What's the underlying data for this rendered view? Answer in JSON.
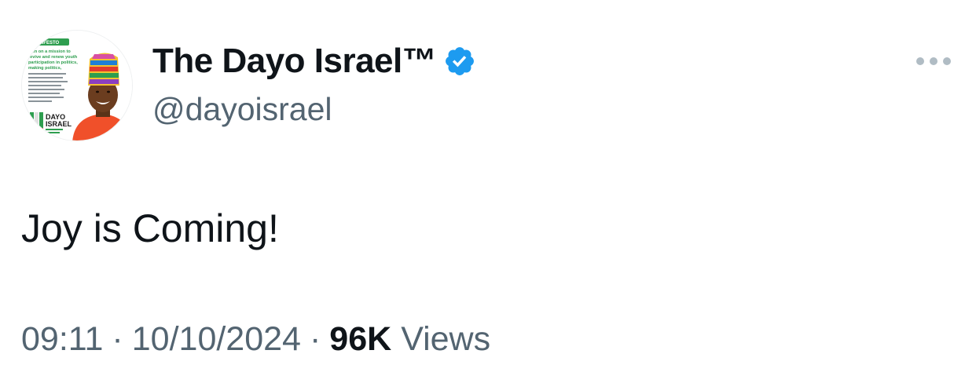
{
  "author": {
    "display_name": "The Dayo Israel™",
    "handle": "@dayoisrael",
    "verified": true,
    "avatar": {
      "badge_text": "MANIFESTO",
      "headline_lines": [
        "I am on a mission to",
        "revive and renew youth",
        "participation in politics,",
        "making politics,"
      ],
      "brand_line_1": "DAYO",
      "brand_line_2": "ISRAEL"
    }
  },
  "tweet": {
    "text": "Joy is Coming!"
  },
  "meta": {
    "time": "09:11",
    "separator": "·",
    "date": "10/10/2024",
    "views_count": "96K",
    "views_label": "Views"
  },
  "colors": {
    "text_primary": "#0f1419",
    "text_secondary": "#536471",
    "verified_blue": "#1d9bf0",
    "more_dots": "#b0bcc4"
  },
  "icons": {
    "verified": "verified-badge-icon",
    "more": "more-options-icon"
  }
}
